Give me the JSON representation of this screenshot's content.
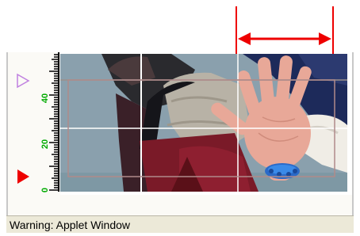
{
  "applet": {
    "status_bar": {
      "text": "Warning: Applet Window"
    },
    "ruler": {
      "tick_labels": [
        "0",
        "20",
        "40"
      ],
      "label_color": "#00aa00",
      "top_marker": {
        "shape": "triangle-outline-right",
        "color": "#c080e0"
      },
      "bottom_marker": {
        "shape": "triangle-filled-right",
        "color": "#ee0000"
      }
    },
    "measure_arrow": {
      "color": "#ee0000",
      "type": "double-headed-horizontal"
    },
    "grid_overlay": {
      "line_color": "#ffffff",
      "rectangle_color": "#b08a8a"
    },
    "image": {
      "description_icon": "photo-hand-icon"
    }
  }
}
